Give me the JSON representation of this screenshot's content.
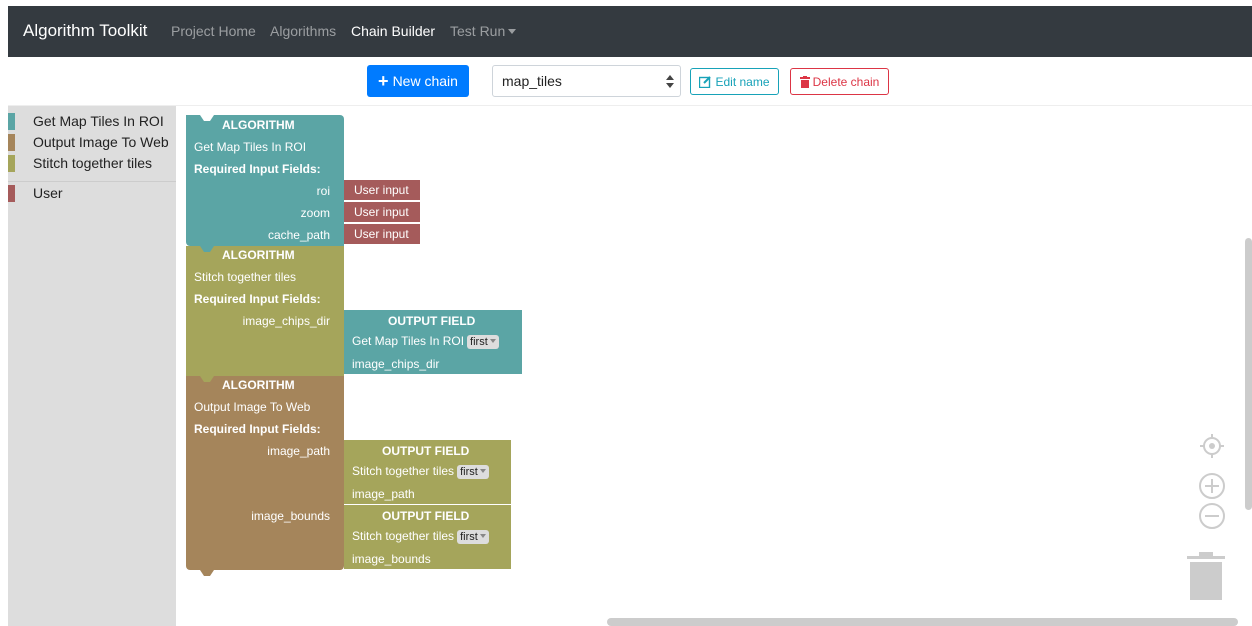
{
  "navbar": {
    "brand": "Algorithm Toolkit",
    "links": [
      {
        "label": "Project Home"
      },
      {
        "label": "Algorithms"
      },
      {
        "label": "Chain Builder"
      },
      {
        "label": "Test Run"
      }
    ]
  },
  "toolbar": {
    "new_chain_label": "New chain",
    "chain_select_value": "map_tiles",
    "edit_name_label": "Edit name",
    "delete_chain_label": "Delete chain"
  },
  "toolbox": {
    "items": [
      {
        "label": "Get Map Tiles In ROI",
        "color": "#5ba5a5"
      },
      {
        "label": "Output Image To Web",
        "color": "#a5855b"
      },
      {
        "label": "Stitch together tiles",
        "color": "#a5a55b"
      },
      {
        "label": "User",
        "color": "#a55b5b"
      }
    ]
  },
  "blocks": {
    "algo1": {
      "header": "ALGORITHM",
      "name": "Get Map Tiles In ROI",
      "required": "Required Input Fields:",
      "fields": [
        "roi",
        "zoom",
        "cache_path"
      ],
      "inputs": [
        "User input",
        "User input",
        "User input"
      ]
    },
    "algo2": {
      "header": "ALGORITHM",
      "name": "Stitch together tiles",
      "required": "Required Input Fields:",
      "fields": [
        "image_chips_dir"
      ],
      "output": {
        "header": "OUTPUT FIELD",
        "source": "Get Map Tiles In ROI",
        "dropdown": "first",
        "field": "image_chips_dir"
      }
    },
    "algo3": {
      "header": "ALGORITHM",
      "name": "Output Image To Web",
      "required": "Required Input Fields:",
      "fields": [
        "image_path",
        "image_bounds"
      ],
      "outputs": [
        {
          "header": "OUTPUT FIELD",
          "source": "Stitch together tiles",
          "dropdown": "first",
          "field": "image_path"
        },
        {
          "header": "OUTPUT FIELD",
          "source": "Stitch together tiles",
          "dropdown": "first",
          "field": "image_bounds"
        }
      ]
    }
  },
  "colors": {
    "teal": "#5ba5a5",
    "olive": "#a5a55b",
    "brown": "#a5855b",
    "red": "#a55b5b",
    "primary": "#007bff",
    "info": "#17a2b8",
    "danger": "#dc3545"
  }
}
